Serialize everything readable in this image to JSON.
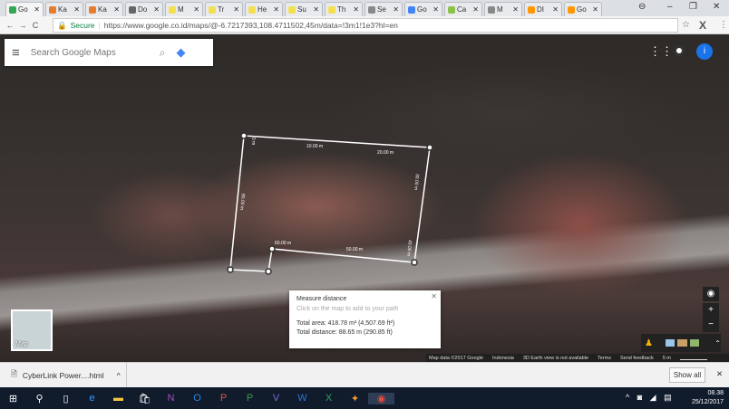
{
  "browser": {
    "tabs": [
      {
        "label": "Go",
        "color": "#34a853"
      },
      {
        "label": "Ka",
        "color": "#e67c2f"
      },
      {
        "label": "Ka",
        "color": "#e67c2f"
      },
      {
        "label": "Do",
        "color": "#666666"
      },
      {
        "label": "M",
        "color": "#f4e04d"
      },
      {
        "label": "Tr",
        "color": "#f4e04d"
      },
      {
        "label": "He",
        "color": "#f4e04d"
      },
      {
        "label": "Su",
        "color": "#f4e04d"
      },
      {
        "label": "Th",
        "color": "#f4e04d"
      },
      {
        "label": "Se",
        "color": "#888888"
      },
      {
        "label": "Go",
        "color": "#4285f4"
      },
      {
        "label": "Ca",
        "color": "#8bc34a"
      },
      {
        "label": "M",
        "color": "#888888"
      },
      {
        "label": "DI",
        "color": "#ff9800"
      },
      {
        "label": "Go",
        "color": "#ff9800"
      }
    ],
    "secure_label": "Secure",
    "url": "https://www.google.co.id/maps/@-6.7217393,108.4711502,45m/data=!3m1!1e3?hl=en"
  },
  "maps": {
    "search_placeholder": "Search Google Maps",
    "account_initial": "i",
    "map_thumb_label": "Map",
    "segment_labels": [
      "0 m",
      "10.00 m",
      "20.00 m",
      "30.00 m",
      "40.00 m",
      "50.00 m",
      "60.00 m",
      "80.00 m"
    ],
    "measure": {
      "title": "Measure distance",
      "hint": "Click on the map to add to your path",
      "area": "Total area: 418.78 m² (4,507.69 ft²)",
      "distance": "Total distance: 88.65 m (290.85 ft)"
    },
    "footer": [
      "Map data ©2017 Google",
      "Indonesia",
      "3D Earth view is not available",
      "Terms",
      "Send feedback",
      "5 m"
    ]
  },
  "downloads": {
    "file": "CyberLink Power....html",
    "show_all": "Show all"
  },
  "taskbar": {
    "time": "08.38",
    "date": "25/12/2017"
  }
}
